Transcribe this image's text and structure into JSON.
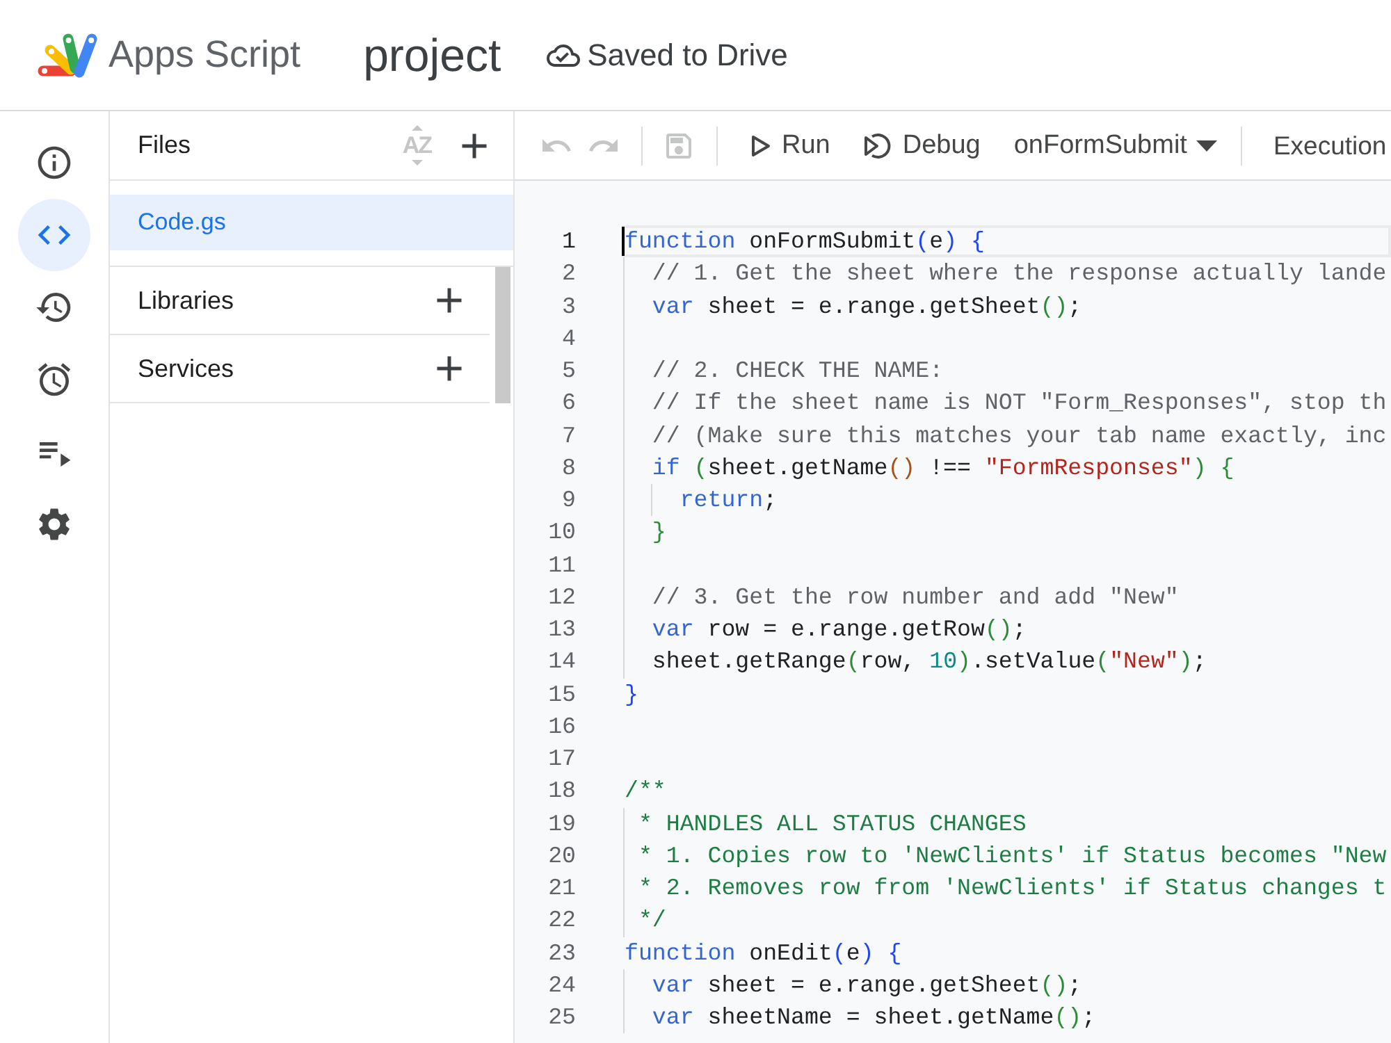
{
  "header": {
    "product": "Apps Script",
    "project": "project",
    "save_status": "Saved to Drive"
  },
  "rail": [
    {
      "kind": "info",
      "selected": false
    },
    {
      "kind": "code",
      "selected": true
    },
    {
      "kind": "history",
      "selected": false
    },
    {
      "kind": "triggers",
      "selected": false
    },
    {
      "kind": "executions",
      "selected": false
    },
    {
      "kind": "settings",
      "selected": false
    }
  ],
  "files_panel": {
    "title": "Files",
    "sort": {
      "label": "AZ",
      "disabled": true
    },
    "files": [
      {
        "name": "Code.gs",
        "selected": true
      }
    ],
    "sections": [
      {
        "title": "Libraries"
      },
      {
        "title": "Services"
      }
    ]
  },
  "toolbar": {
    "undo": {
      "disabled": true
    },
    "redo": {
      "disabled": true
    },
    "save": {
      "disabled": true
    },
    "run": {
      "label": "Run"
    },
    "debug": {
      "label": "Debug"
    },
    "function_select": {
      "value": "onFormSubmit"
    },
    "execution": {
      "label": "Execution"
    }
  },
  "editor": {
    "lines": [
      {
        "number": "1",
        "current": true,
        "tokens": [
          {
            "kind": "keyword",
            "text": "function"
          },
          {
            "kind": "plain",
            "text": " onFormSubmit"
          },
          {
            "kind": "brace1",
            "text": "("
          },
          {
            "kind": "plain",
            "text": "e"
          },
          {
            "kind": "brace1",
            "text": ")"
          },
          {
            "kind": "brace1",
            "text": " {"
          }
        ]
      },
      {
        "number": "2",
        "current": false,
        "tokens": [
          {
            "kind": "comment",
            "text": "  // 1. Get the sheet where the response actually lande"
          }
        ]
      },
      {
        "number": "3",
        "current": false,
        "tokens": [
          {
            "kind": "keyword",
            "text": "  var"
          },
          {
            "kind": "plain",
            "text": " sheet = e.range.getSheet"
          },
          {
            "kind": "brace2",
            "text": "()"
          },
          {
            "kind": "plain",
            "text": ";"
          }
        ]
      },
      {
        "number": "4",
        "current": false
      },
      {
        "number": "5",
        "current": false,
        "tokens": [
          {
            "kind": "comment",
            "text": "  // 2. CHECK THE NAME:"
          }
        ]
      },
      {
        "number": "6",
        "current": false,
        "tokens": [
          {
            "kind": "comment",
            "text": "  // If the sheet name is NOT \"Form_Responses\", stop th"
          }
        ]
      },
      {
        "number": "7",
        "current": false,
        "tokens": [
          {
            "kind": "comment",
            "text": "  // (Make sure this matches your tab name exactly, inc"
          }
        ]
      },
      {
        "number": "8",
        "current": false,
        "tokens": [
          {
            "kind": "keyword",
            "text": "  if"
          },
          {
            "kind": "brace2",
            "text": " ("
          },
          {
            "kind": "plain",
            "text": "sheet.getName"
          },
          {
            "kind": "brace3",
            "text": "()"
          },
          {
            "kind": "plain",
            "text": " !== "
          },
          {
            "kind": "string",
            "text": "\"FormResponses\""
          },
          {
            "kind": "brace2",
            "text": ")"
          },
          {
            "kind": "brace2",
            "text": " {"
          }
        ]
      },
      {
        "number": "9",
        "current": false,
        "tokens": [
          {
            "kind": "keyword",
            "text": "    return"
          },
          {
            "kind": "plain",
            "text": ";"
          }
        ]
      },
      {
        "number": "10",
        "current": false,
        "tokens": [
          {
            "kind": "brace2",
            "text": "  }"
          }
        ]
      },
      {
        "number": "11",
        "current": false
      },
      {
        "number": "12",
        "current": false,
        "tokens": [
          {
            "kind": "comment",
            "text": "  // 3. Get the row number and add \"New\""
          }
        ]
      },
      {
        "number": "13",
        "current": false,
        "tokens": [
          {
            "kind": "keyword",
            "text": "  var"
          },
          {
            "kind": "plain",
            "text": " row = e.range.getRow"
          },
          {
            "kind": "brace2",
            "text": "()"
          },
          {
            "kind": "plain",
            "text": ";"
          }
        ]
      },
      {
        "number": "14",
        "current": false,
        "tokens": [
          {
            "kind": "plain",
            "text": "  sheet.getRange"
          },
          {
            "kind": "brace2",
            "text": "("
          },
          {
            "kind": "plain",
            "text": "row, "
          },
          {
            "kind": "number",
            "text": "10"
          },
          {
            "kind": "brace2",
            "text": ")"
          },
          {
            "kind": "plain",
            "text": ".setValue"
          },
          {
            "kind": "brace2",
            "text": "("
          },
          {
            "kind": "string",
            "text": "\"New\""
          },
          {
            "kind": "brace2",
            "text": ")"
          },
          {
            "kind": "plain",
            "text": ";"
          }
        ]
      },
      {
        "number": "15",
        "current": false,
        "tokens": [
          {
            "kind": "brace1",
            "text": "}"
          }
        ]
      },
      {
        "number": "16",
        "current": false
      },
      {
        "number": "17",
        "current": false
      },
      {
        "number": "18",
        "current": false,
        "tokens": [
          {
            "kind": "doc",
            "text": "/**"
          }
        ]
      },
      {
        "number": "19",
        "current": false,
        "tokens": [
          {
            "kind": "doc",
            "text": " * HANDLES ALL STATUS CHANGES"
          }
        ]
      },
      {
        "number": "20",
        "current": false,
        "tokens": [
          {
            "kind": "doc",
            "text": " * 1. Copies row to 'NewClients' if Status becomes \"New"
          }
        ]
      },
      {
        "number": "21",
        "current": false,
        "tokens": [
          {
            "kind": "doc",
            "text": " * 2. Removes row from 'NewClients' if Status changes t"
          }
        ]
      },
      {
        "number": "22",
        "current": false,
        "tokens": [
          {
            "kind": "doc",
            "text": " */"
          }
        ]
      },
      {
        "number": "23",
        "current": false,
        "tokens": [
          {
            "kind": "keyword",
            "text": "function"
          },
          {
            "kind": "plain",
            "text": " onEdit"
          },
          {
            "kind": "brace1",
            "text": "("
          },
          {
            "kind": "plain",
            "text": "e"
          },
          {
            "kind": "brace1",
            "text": ")"
          },
          {
            "kind": "brace1",
            "text": " {"
          }
        ]
      },
      {
        "number": "24",
        "current": false,
        "tokens": [
          {
            "kind": "keyword",
            "text": "  var"
          },
          {
            "kind": "plain",
            "text": " sheet = e.range.getSheet"
          },
          {
            "kind": "brace2",
            "text": "()"
          },
          {
            "kind": "plain",
            "text": ";"
          }
        ]
      },
      {
        "number": "25",
        "current": false,
        "tokens": [
          {
            "kind": "keyword",
            "text": "  var"
          },
          {
            "kind": "plain",
            "text": " sheetName = sheet.getName"
          },
          {
            "kind": "brace2",
            "text": "()"
          },
          {
            "kind": "plain",
            "text": ";"
          }
        ]
      }
    ]
  }
}
